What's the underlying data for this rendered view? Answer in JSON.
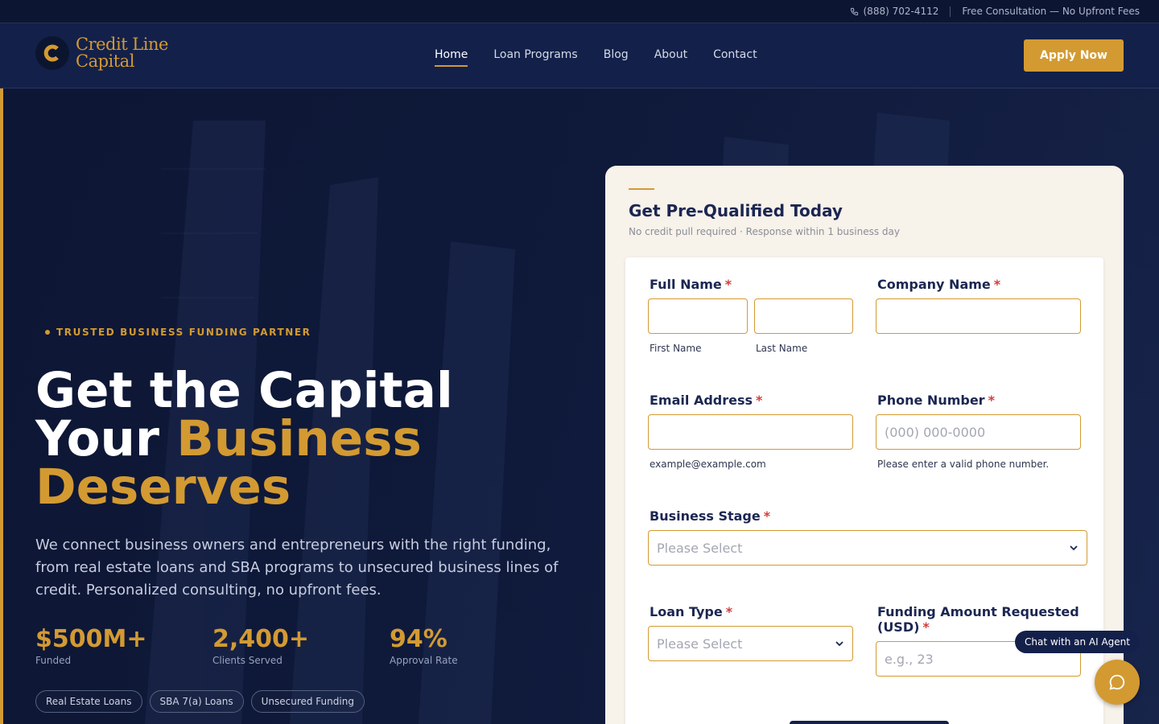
{
  "topbar": {
    "phone": "(888) 702-4112",
    "notice": "Free Consultation — No Upfront Fees"
  },
  "brand": {
    "line1": "Credit Line",
    "line2": "Capital",
    "mark_letter": "C"
  },
  "nav": {
    "items": [
      {
        "label": "Home",
        "active": true
      },
      {
        "label": "Loan Programs",
        "active": false
      },
      {
        "label": "Blog",
        "active": false
      },
      {
        "label": "About",
        "active": false
      },
      {
        "label": "Contact",
        "active": false
      }
    ]
  },
  "header": {
    "cta_label": "Apply Now"
  },
  "hero": {
    "eyebrow": "TRUSTED BUSINESS FUNDING PARTNER",
    "headline_line1": "Get the Capital",
    "headline_line2_plain": "Your ",
    "headline_line2_gold": "Business",
    "headline_line3_gold": "Deserves",
    "copy": "We connect business owners and entrepreneurs with the right funding, from real estate loans and SBA programs to unsecured business lines of credit. Personalized consulting, no upfront fees.",
    "stats": [
      {
        "value": "$500M+",
        "label": "Funded"
      },
      {
        "value": "2,400+",
        "label": "Clients Served"
      },
      {
        "value": "94%",
        "label": "Approval Rate"
      }
    ],
    "tags": [
      "Real Estate Loans",
      "SBA 7(a) Loans",
      "Unsecured Funding"
    ]
  },
  "form": {
    "title": "Get Pre-Qualified Today",
    "subtitle": "No credit pull required · Response within 1 business day",
    "required_mark": "*",
    "full_name": {
      "label": "Full Name",
      "first_help": "First Name",
      "last_help": "Last Name",
      "first_value": "",
      "last_value": ""
    },
    "company": {
      "label": "Company Name",
      "value": ""
    },
    "email": {
      "label": "Email Address",
      "value": "",
      "help": "example@example.com"
    },
    "phone": {
      "label": "Phone Number",
      "placeholder": "(000) 000-0000",
      "help": "Please enter a valid phone number."
    },
    "business_stage": {
      "label": "Business Stage",
      "selected": "Please Select"
    },
    "loan_type": {
      "label": "Loan Type",
      "selected": "Please Select"
    },
    "funding_amount": {
      "label": "Funding Amount Requested (USD)",
      "placeholder": "e.g., 23"
    }
  },
  "chat": {
    "label": "Chat with an AI Agent"
  },
  "colors": {
    "navy": "#13204a",
    "gold": "#d39a32",
    "cream": "#f7f2ea",
    "required": "#d43c3c"
  }
}
